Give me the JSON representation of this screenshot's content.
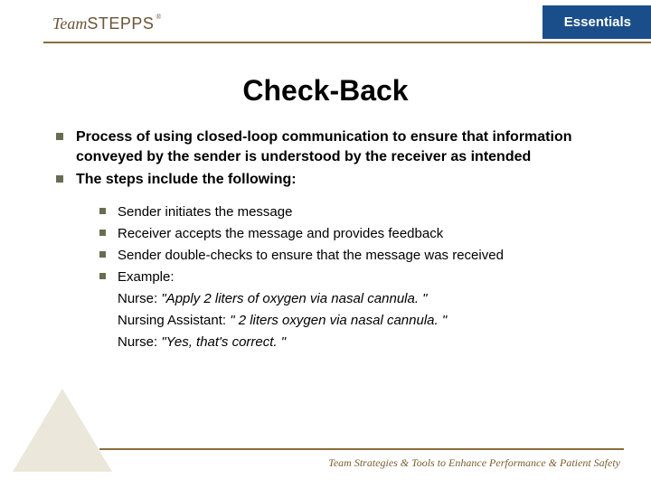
{
  "header": {
    "logo_team": "Team",
    "logo_stepps": "STEPPS",
    "reg": "®",
    "tab": "Essentials"
  },
  "title": "Check-Back",
  "bullets_lvl1": [
    "Process of using closed-loop communication to ensure that information conveyed by the sender is understood by the receiver as intended",
    "The steps include the following:"
  ],
  "bullets_lvl2": [
    {
      "text": "Sender initiates the message",
      "bullet": true
    },
    {
      "text": "Receiver accepts the message and provides feedback",
      "bullet": true
    },
    {
      "text": "Sender double-checks to ensure that the message was received",
      "bullet": true
    },
    {
      "text": "Example:",
      "bullet": true
    },
    {
      "prefix": "Nurse: ",
      "quote": "\"Apply 2 liters of oxygen via nasal cannula. \"",
      "bullet": false
    },
    {
      "prefix": "Nursing Assistant: ",
      "quote": "\" 2 liters oxygen via nasal cannula. \"",
      "bullet": false
    },
    {
      "prefix": "Nurse: ",
      "quote": "\"Yes, that's correct. \"",
      "bullet": false
    }
  ],
  "footer": {
    "tagline": "Team Strategies & Tools to Enhance Performance & Patient Safety"
  }
}
